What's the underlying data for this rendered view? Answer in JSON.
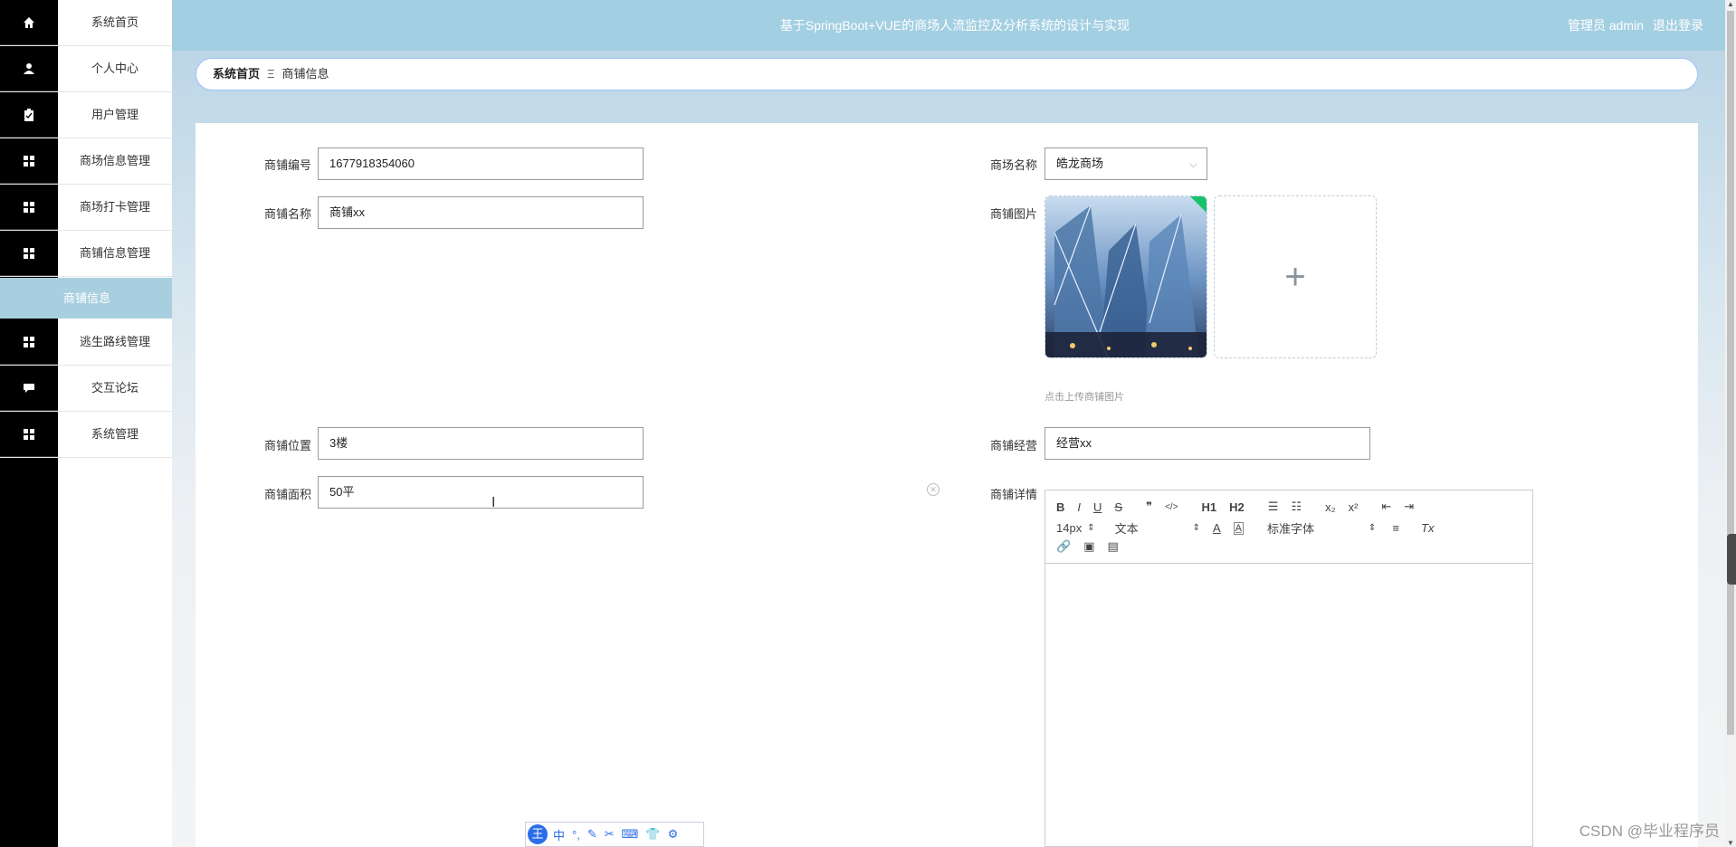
{
  "header": {
    "title": "基于SpringBoot+VUE的商场人流监控及分析系统的设计与实现",
    "user_label": "管理员 admin",
    "logout": "退出登录"
  },
  "sidebar": {
    "items": [
      {
        "label": "系统首页",
        "icon": "home-icon"
      },
      {
        "label": "个人中心",
        "icon": "user-icon"
      },
      {
        "label": "用户管理",
        "icon": "clipboard-icon"
      },
      {
        "label": "商场信息管理",
        "icon": "grid-icon"
      },
      {
        "label": "商场打卡管理",
        "icon": "grid-icon"
      },
      {
        "label": "商铺信息管理",
        "icon": "grid-icon"
      },
      {
        "label": "逃生路线管理",
        "icon": "grid-icon"
      },
      {
        "label": "交互论坛",
        "icon": "chat-icon"
      },
      {
        "label": "系统管理",
        "icon": "grid-icon"
      }
    ],
    "sub_active": "商铺信息"
  },
  "breadcrumb": {
    "home": "系统首页",
    "separator": "Ξ",
    "current": "商铺信息"
  },
  "form": {
    "shop_no_label": "商铺编号",
    "shop_no_value": "1677918354060",
    "mall_name_label": "商场名称",
    "mall_name_value": "皓龙商场",
    "shop_name_label": "商铺名称",
    "shop_name_value": "商铺xx",
    "shop_image_label": "商铺图片",
    "upload_hint": "点击上传商铺图片",
    "location_label": "商铺位置",
    "location_value": "3楼",
    "business_label": "商铺经营",
    "business_value": "经营xx",
    "area_label": "商铺面积",
    "area_value": "50平",
    "detail_label": "商铺详情"
  },
  "editor": {
    "row1": [
      "B",
      "I",
      "U",
      "S",
      "❞",
      "</>",
      "H1",
      "H2",
      "☰",
      "☷",
      "x₂",
      "x²",
      "⇤",
      "⇥"
    ],
    "font_size": "14px",
    "text_type": "文本",
    "font_family": "标准字体",
    "row2_tools": [
      "A",
      "A̲",
      "≡",
      "Tx"
    ],
    "row3": [
      "🔗",
      "▣",
      "▤"
    ]
  },
  "ime": {
    "badge": "王",
    "items": [
      "中",
      "°,",
      "✎",
      "✂",
      "⌨",
      "👕",
      "⚙"
    ]
  },
  "watermark": "CSDN @毕业程序员"
}
